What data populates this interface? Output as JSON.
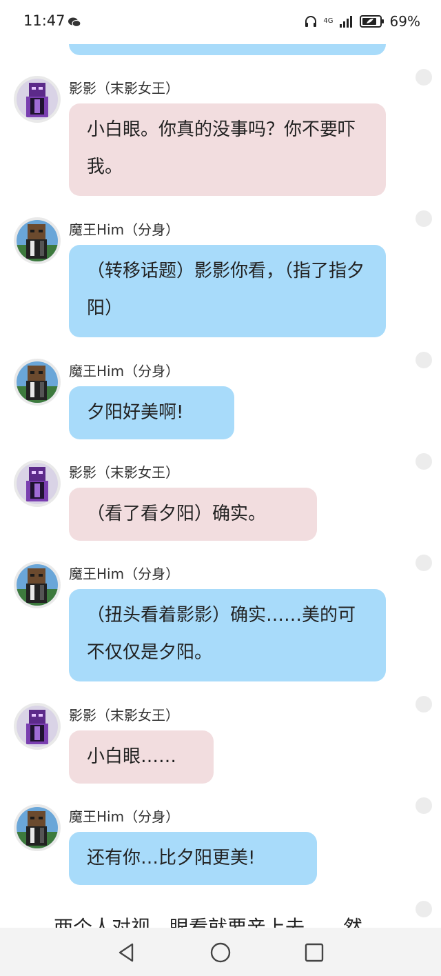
{
  "status_bar": {
    "time": "11:47",
    "network": "4G",
    "battery_percent": "69%"
  },
  "messages": [
    {
      "sender": "影影（末影女王）",
      "text": "小白眼。你真的没事吗？你不要吓我。",
      "side": "pink"
    },
    {
      "sender": "魔王Him（分身）",
      "text": "（转移话题）影影你看，（指了指夕阳）",
      "side": "blue"
    },
    {
      "sender": "魔王Him（分身）",
      "text": "夕阳好美啊!",
      "side": "blue"
    },
    {
      "sender": "影影（末影女王）",
      "text": "（看了看夕阳）确实。",
      "side": "pink"
    },
    {
      "sender": "魔王Him（分身）",
      "text": "（扭头看着影影）确实……美的可不仅仅是夕阳。",
      "side": "blue"
    },
    {
      "sender": "影影（末影女王）",
      "text": "小白眼……",
      "side": "pink"
    },
    {
      "sender": "魔王Him（分身）",
      "text": "还有你…比夕阳更美!",
      "side": "blue"
    }
  ],
  "narration": "两个人对视，眼看就要亲上去……然",
  "colors": {
    "blue_bubble": "#a8dbfa",
    "pink_bubble": "#f2dddf"
  },
  "icons": {
    "status": [
      "wechat-icon",
      "headphones-icon",
      "signal-icon",
      "battery-icon"
    ],
    "nav": [
      "back-icon",
      "home-icon",
      "recents-icon"
    ]
  }
}
